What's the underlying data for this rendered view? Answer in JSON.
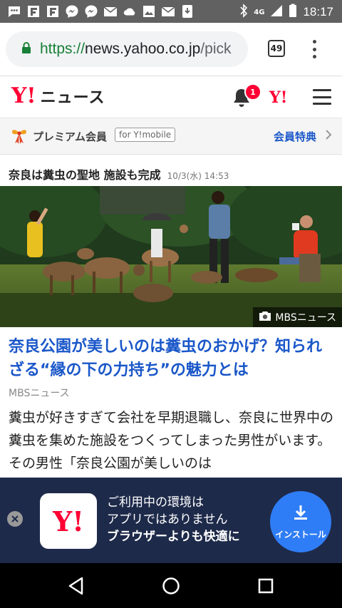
{
  "status_bar": {
    "time": "18:17",
    "network": "4G",
    "notification_icons": [
      "messages-icon",
      "flipboard-icon",
      "flipboard-icon",
      "messenger-icon",
      "messenger-icon",
      "mail-icon",
      "cloud-sync-icon",
      "image-icon",
      "mail-icon",
      "download-icon"
    ],
    "system_icons": [
      "bluetooth-icon",
      "signal-icon",
      "battery-icon"
    ]
  },
  "browser": {
    "url_scheme": "https://",
    "url_host": "news.yahoo.co.jp",
    "url_path": "/pick",
    "tab_count": "49",
    "colors": {
      "secure": "#188038"
    }
  },
  "header": {
    "logo_mark": "Y!",
    "logo_text": "ニュース",
    "notification_count": "1",
    "yahoo_mark": "Y!",
    "brand_color": "#ff0033"
  },
  "premium": {
    "label": "プレミアム会員",
    "tag": "for Y!mobile",
    "link": "会員特典"
  },
  "headline": {
    "title": "奈良は糞虫の聖地 施設も完成",
    "date": "10/3(水) 14:53"
  },
  "photo": {
    "credit": "MBSニュース",
    "subject": "deer-in-nara-park"
  },
  "article": {
    "title": "奈良公園が美しいのは糞虫のおかげ？知られざる“縁の下の力持ち”の魅力とは",
    "source": "MBSニュース",
    "body": "糞虫が好きすぎて会社を早期退職し、奈良に世界中の糞虫を集めた施設をつくってしまった男性がいます。その男性「奈良公園が美しいのは",
    "link_color": "#1a57c9"
  },
  "app_banner": {
    "icon_mark": "Y!",
    "line1": "ご利用中の環境は",
    "line2": "アプリではありません",
    "line3": "ブラウザーよりも快適に",
    "install_label": "インストール",
    "background": "#1e2a4a",
    "button_color": "#2f7df6"
  },
  "nav_bar": {
    "buttons": [
      "back-icon",
      "home-icon",
      "recents-icon"
    ]
  }
}
